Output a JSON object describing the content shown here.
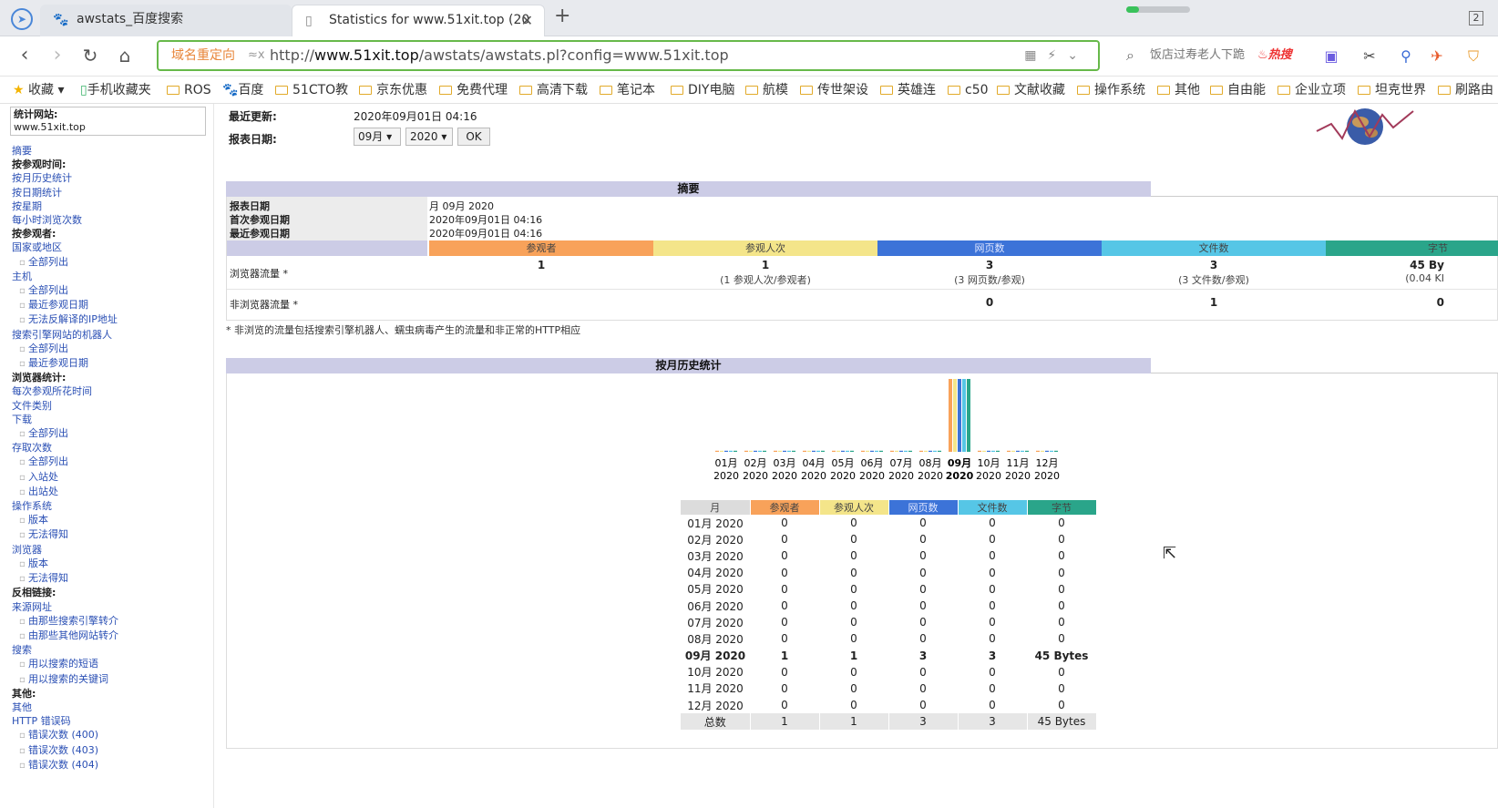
{
  "browser": {
    "tabs": [
      {
        "title": "awstats_百度搜索"
      },
      {
        "title": "Statistics for www.51xit.top (20"
      }
    ],
    "tab_count": "2",
    "address_bar": {
      "redirect_label": "域名重定向",
      "url_prefix": "http://",
      "url_host": "www.51xit.top",
      "url_path": "/awstats/awstats.pl?config=www.51xit.top"
    },
    "search_box": {
      "placeholder": "饭店过寿老人下跪",
      "hot_label": "热搜"
    },
    "bookmarks": [
      "收藏",
      "手机收藏夹",
      "ROS",
      "百度",
      "51CTO教",
      "京东优惠",
      "免费代理",
      "高清下载",
      "笔记本",
      "DIY电脑",
      "航模",
      "传世架设",
      "英雄连",
      "c50",
      "文献收藏",
      "操作系统",
      "其他",
      "自由能",
      "企业立项",
      "坦克世界",
      "刷路由"
    ]
  },
  "sidebar": {
    "site_label": "统计网站:",
    "site_value": "www.51xit.top",
    "menu": [
      {
        "t": "lnk",
        "text": "摘要"
      },
      {
        "t": "sec",
        "text": "按参观时间:"
      },
      {
        "t": "lnk",
        "text": "按月历史统计"
      },
      {
        "t": "lnk",
        "text": "按日期统计"
      },
      {
        "t": "lnk",
        "text": "按星期"
      },
      {
        "t": "lnk",
        "text": "每小时浏览次数"
      },
      {
        "t": "sec",
        "text": "按参观者:"
      },
      {
        "t": "lnk",
        "text": "国家或地区"
      },
      {
        "t": "sub",
        "text": "全部列出"
      },
      {
        "t": "lnk",
        "text": "主机"
      },
      {
        "t": "sub",
        "text": "全部列出"
      },
      {
        "t": "sub",
        "text": "最近参观日期"
      },
      {
        "t": "sub",
        "text": "无法反解译的IP地址"
      },
      {
        "t": "lnk",
        "text": "搜索引擎网站的机器人"
      },
      {
        "t": "sub",
        "text": "全部列出"
      },
      {
        "t": "sub",
        "text": "最近参观日期"
      },
      {
        "t": "sec",
        "text": "浏览器统计:"
      },
      {
        "t": "lnk",
        "text": "每次参观所花时间"
      },
      {
        "t": "lnk",
        "text": "文件类别"
      },
      {
        "t": "lnk",
        "text": "下载"
      },
      {
        "t": "sub",
        "text": "全部列出"
      },
      {
        "t": "lnk",
        "text": "存取次数"
      },
      {
        "t": "sub",
        "text": "全部列出"
      },
      {
        "t": "sub",
        "text": "入站处"
      },
      {
        "t": "sub",
        "text": "出站处"
      },
      {
        "t": "lnk",
        "text": "操作系统"
      },
      {
        "t": "sub",
        "text": "版本"
      },
      {
        "t": "sub",
        "text": "无法得知"
      },
      {
        "t": "lnk",
        "text": "浏览器"
      },
      {
        "t": "sub",
        "text": "版本"
      },
      {
        "t": "sub",
        "text": "无法得知"
      },
      {
        "t": "sec",
        "text": "反相链接:"
      },
      {
        "t": "lnk",
        "text": "来源网址"
      },
      {
        "t": "sub",
        "text": "由那些搜索引擎转介"
      },
      {
        "t": "sub",
        "text": "由那些其他网站转介"
      },
      {
        "t": "lnk",
        "text": "搜索"
      },
      {
        "t": "sub",
        "text": "用以搜索的短语"
      },
      {
        "t": "sub",
        "text": "用以搜索的关键词"
      },
      {
        "t": "sec",
        "text": "其他:"
      },
      {
        "t": "lnk",
        "text": "其他"
      },
      {
        "t": "lnk",
        "text": "HTTP 错误码"
      },
      {
        "t": "sub",
        "text": "错误次数 (400)"
      },
      {
        "t": "sub",
        "text": "错误次数 (403)"
      },
      {
        "t": "sub",
        "text": "错误次数 (404)"
      }
    ]
  },
  "topinfo": {
    "last_update_label": "最近更新:",
    "last_update_value": "2020年09月01日 04:16",
    "report_date_label": "报表日期:",
    "month_select": "09月",
    "year_select": "2020",
    "ok_label": "OK"
  },
  "summary": {
    "title": "摘要",
    "rows": [
      {
        "label": "报表日期",
        "value": "月 09月 2020"
      },
      {
        "label": "首次参观日期",
        "value": "2020年09月01日 04:16"
      },
      {
        "label": "最近参观日期",
        "value": "2020年09月01日 04:16"
      }
    ],
    "columns": [
      {
        "label": "参观者",
        "color": "#f8a25a"
      },
      {
        "label": "参观人次",
        "color": "#f4e58a"
      },
      {
        "label": "网页数",
        "color": "#3c73d8"
      },
      {
        "label": "文件数",
        "color": "#56c6e6"
      },
      {
        "label": "字节",
        "color": "#2aa58a"
      }
    ],
    "browser_traffic_label": "浏览器流量 *",
    "browser_values": [
      "1",
      "1",
      "3",
      "3",
      "45 By"
    ],
    "browser_subs": [
      "",
      "(1 参观人次/参观者)",
      "(3 网页数/参观)",
      "(3 文件数/参观)",
      "(0.04 KI"
    ],
    "nonbrowser_traffic_label": "非浏览器流量 *",
    "nonbrowser_values": [
      "",
      "",
      "0",
      "1",
      "0"
    ],
    "footnote": "* 非浏览的流量包括搜索引擎机器人、蠕虫病毒产生的流量和非正常的HTTP相应"
  },
  "monthly": {
    "title": "按月历史统计",
    "headers": [
      "月",
      "参观者",
      "参观人次",
      "网页数",
      "文件数",
      "字节"
    ],
    "rows": [
      [
        "01月 2020",
        "0",
        "0",
        "0",
        "0",
        "0"
      ],
      [
        "02月 2020",
        "0",
        "0",
        "0",
        "0",
        "0"
      ],
      [
        "03月 2020",
        "0",
        "0",
        "0",
        "0",
        "0"
      ],
      [
        "04月 2020",
        "0",
        "0",
        "0",
        "0",
        "0"
      ],
      [
        "05月 2020",
        "0",
        "0",
        "0",
        "0",
        "0"
      ],
      [
        "06月 2020",
        "0",
        "0",
        "0",
        "0",
        "0"
      ],
      [
        "07月 2020",
        "0",
        "0",
        "0",
        "0",
        "0"
      ],
      [
        "08月 2020",
        "0",
        "0",
        "0",
        "0",
        "0"
      ],
      [
        "09月 2020",
        "1",
        "1",
        "3",
        "3",
        "45 Bytes"
      ],
      [
        "10月 2020",
        "0",
        "0",
        "0",
        "0",
        "0"
      ],
      [
        "11月 2020",
        "0",
        "0",
        "0",
        "0",
        "0"
      ],
      [
        "12月 2020",
        "0",
        "0",
        "0",
        "0",
        "0"
      ]
    ],
    "total_row": [
      "总数",
      "1",
      "1",
      "3",
      "3",
      "45 Bytes"
    ],
    "current_month_index": 8
  },
  "chart_data": {
    "type": "bar",
    "categories": [
      "01月 2020",
      "02月 2020",
      "03月 2020",
      "04月 2020",
      "05月 2020",
      "06月 2020",
      "07月 2020",
      "08月 2020",
      "09月 2020",
      "10月 2020",
      "11月 2020",
      "12月 2020"
    ],
    "month_labels": [
      "01月",
      "02月",
      "03月",
      "04月",
      "05月",
      "06月",
      "07月",
      "08月",
      "09月",
      "10月",
      "11月",
      "12月"
    ],
    "year_labels": [
      "2020",
      "2020",
      "2020",
      "2020",
      "2020",
      "2020",
      "2020",
      "2020",
      "2020",
      "2020",
      "2020",
      "2020"
    ],
    "series": [
      {
        "name": "参观者",
        "color": "#f8a25a",
        "values": [
          0,
          0,
          0,
          0,
          0,
          0,
          0,
          0,
          1,
          0,
          0,
          0
        ]
      },
      {
        "name": "参观人次",
        "color": "#f4e58a",
        "values": [
          0,
          0,
          0,
          0,
          0,
          0,
          0,
          0,
          1,
          0,
          0,
          0
        ]
      },
      {
        "name": "网页数",
        "color": "#3c73d8",
        "values": [
          0,
          0,
          0,
          0,
          0,
          0,
          0,
          0,
          3,
          0,
          0,
          0
        ]
      },
      {
        "name": "文件数",
        "color": "#56c6e6",
        "values": [
          0,
          0,
          0,
          0,
          0,
          0,
          0,
          0,
          3,
          0,
          0,
          0
        ]
      },
      {
        "name": "字节",
        "color": "#2aa58a",
        "values": [
          0,
          0,
          0,
          0,
          0,
          0,
          0,
          0,
          45,
          0,
          0,
          0
        ]
      }
    ],
    "grid": false,
    "legend": "none"
  }
}
